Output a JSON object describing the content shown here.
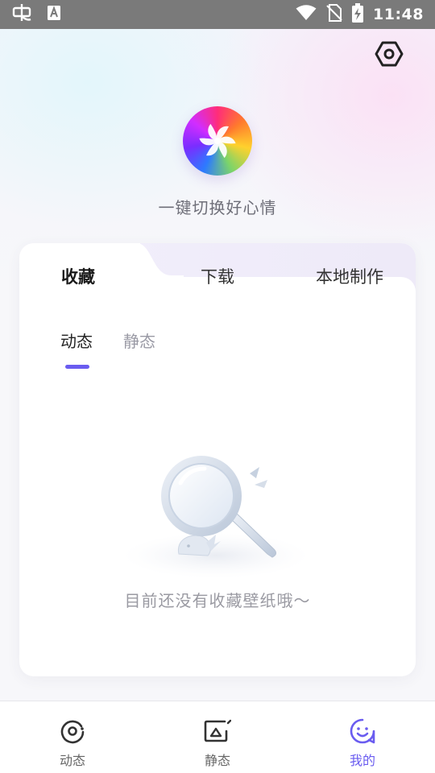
{
  "status_bar": {
    "time": "11:48",
    "left_icons": [
      "bug-notification-icon",
      "font-notification-icon"
    ],
    "right_icons": [
      "wifi-icon",
      "no-sim-icon",
      "battery-charging-icon"
    ]
  },
  "header": {
    "settings_icon": "hexagon-settings-icon",
    "slogan": "一键切换好心情"
  },
  "main_tabs": [
    {
      "label": "收藏",
      "active": true
    },
    {
      "label": "下载",
      "active": false
    },
    {
      "label": "本地制作",
      "active": false
    }
  ],
  "sub_tabs": [
    {
      "label": "动态",
      "active": true
    },
    {
      "label": "静态",
      "active": false
    }
  ],
  "empty_state": {
    "message": "目前还没有收藏壁纸哦～",
    "illustration": "magnifier-whale-illustration"
  },
  "bottom_nav": [
    {
      "label": "动态",
      "icon": "dynamic-disc-icon",
      "active": false
    },
    {
      "label": "静态",
      "icon": "static-image-icon",
      "active": false
    },
    {
      "label": "我的",
      "icon": "mine-ghost-icon",
      "active": true
    }
  ],
  "colors": {
    "accent": "#6a5cf0",
    "status_bar": "#7a7a7a",
    "text_muted": "#9a9aa2"
  }
}
